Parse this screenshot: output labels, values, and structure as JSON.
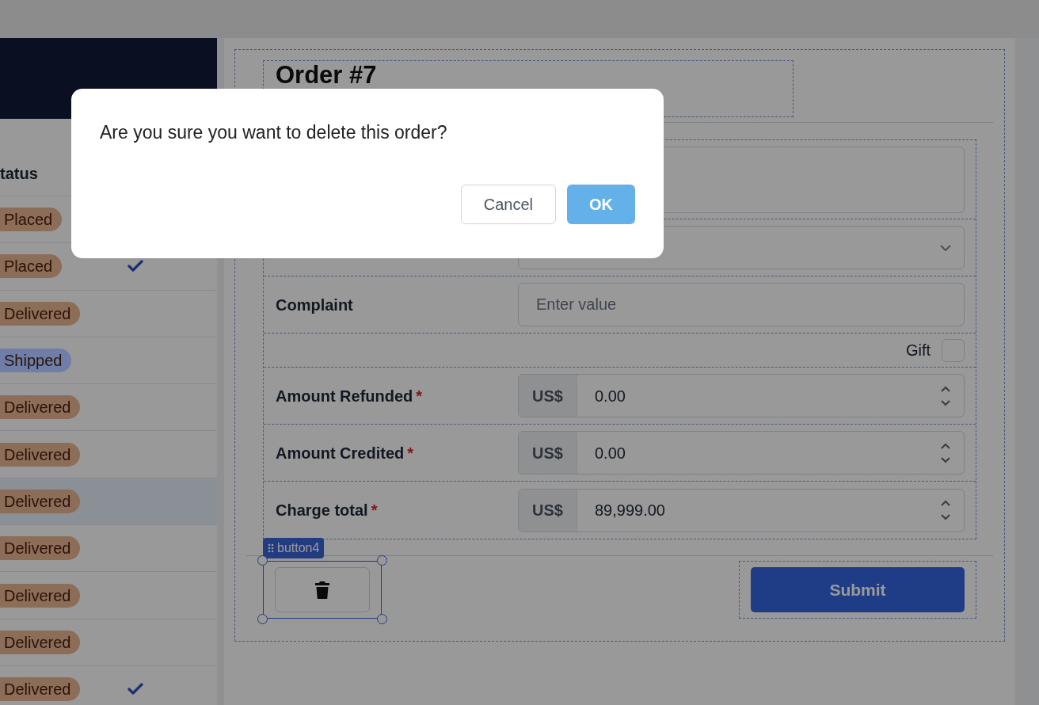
{
  "orders_table": {
    "status_header": "tatus",
    "rows": [
      {
        "status": "Placed",
        "color": "#8c6d58",
        "checked": false,
        "selected": false
      },
      {
        "status": "Placed",
        "color": "#8c6d58",
        "checked": true,
        "selected": false
      },
      {
        "status": "Delivered",
        "color": "#8c6d58",
        "checked": false,
        "selected": false
      },
      {
        "status": "Shipped",
        "color": "#6f7ea6",
        "checked": false,
        "selected": false
      },
      {
        "status": "Delivered",
        "color": "#8c6d58",
        "checked": false,
        "selected": false
      },
      {
        "status": "Delivered",
        "color": "#8c6d58",
        "checked": false,
        "selected": false
      },
      {
        "status": "Delivered",
        "color": "#8c6d58",
        "checked": false,
        "selected": true
      },
      {
        "status": "Delivered",
        "color": "#8c6d58",
        "checked": false,
        "selected": false
      },
      {
        "status": "Delivered",
        "color": "#8c6d58",
        "checked": false,
        "selected": false
      },
      {
        "status": "Delivered",
        "color": "#8c6d58",
        "checked": false,
        "selected": false
      },
      {
        "status": "Delivered",
        "color": "#8c6d58",
        "checked": true,
        "selected": false
      }
    ]
  },
  "form": {
    "title": "Order #7",
    "fields": [
      {
        "kind": "textarea"
      },
      {
        "kind": "select"
      },
      {
        "kind": "text",
        "label": "Complaint",
        "placeholder": "Enter value"
      },
      {
        "kind": "checkbox",
        "label": "Gift",
        "checked": false
      },
      {
        "kind": "currency",
        "label": "Amount Refunded",
        "required_mark": "*",
        "prefix": "US$",
        "value": "0.00"
      },
      {
        "kind": "currency",
        "label": "Amount Credited",
        "required_mark": "*",
        "prefix": "US$",
        "value": "0.00"
      },
      {
        "kind": "currency",
        "label": "Charge total",
        "required_mark": "*",
        "prefix": "US$",
        "value": "89,999.00"
      }
    ],
    "selected_component_tag": "button4",
    "submit": "Submit"
  },
  "dialog": {
    "message": "Are you sure you want to delete this order?",
    "buttons": [
      {
        "label": "Cancel",
        "kind": "secondary"
      },
      {
        "label": "OK",
        "kind": "primary"
      }
    ]
  }
}
